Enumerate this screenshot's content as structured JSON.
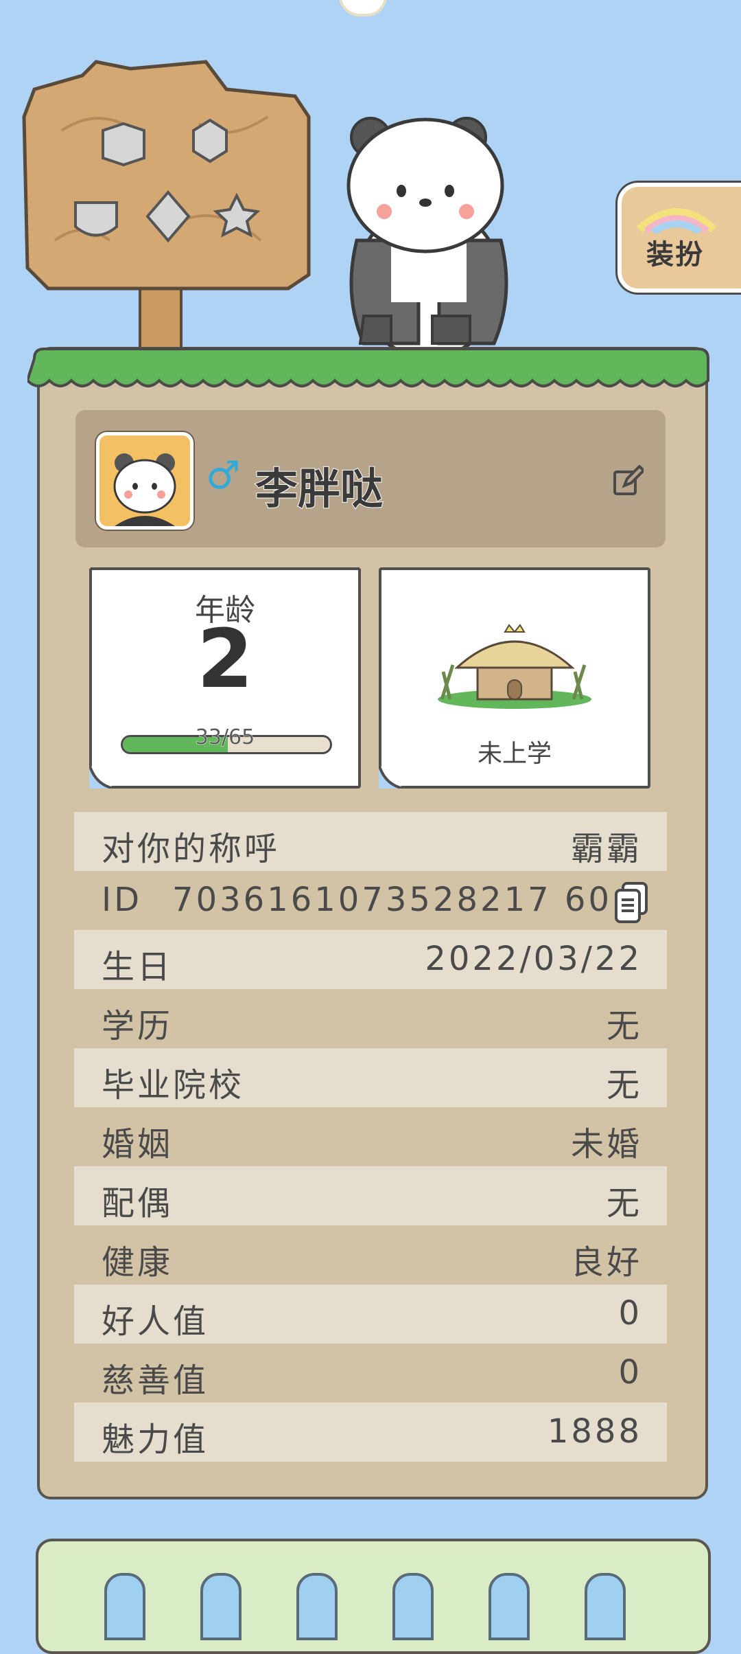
{
  "profile": {
    "nickname": "李胖哒",
    "gender_symbol": "♂"
  },
  "dress_button": {
    "label": "装扮"
  },
  "age_card": {
    "title": "年龄",
    "value": "2",
    "progress_text": "33/65",
    "progress_fraction": 0.507
  },
  "school_card": {
    "status": "未上学"
  },
  "info": {
    "address": {
      "label": "对你的称呼",
      "value": "霸霸"
    },
    "id": {
      "label": "ID",
      "value": "7036161073528217 60"
    },
    "birthday": {
      "label": "生日",
      "value": "2022/03/22"
    },
    "education": {
      "label": "学历",
      "value": "无"
    },
    "school": {
      "label": "毕业院校",
      "value": "无"
    },
    "marriage": {
      "label": "婚姻",
      "value": "未婚"
    },
    "spouse": {
      "label": "配偶",
      "value": "无"
    },
    "health": {
      "label": "健康",
      "value": "良好"
    },
    "good_person": {
      "label": "好人值",
      "value": "0"
    },
    "charity": {
      "label": "慈善值",
      "value": "0"
    },
    "charm": {
      "label": "魅力值",
      "value": "1888"
    }
  },
  "icons": {
    "edit": "edit-icon",
    "copy": "copy-icon",
    "gender": "male-icon"
  },
  "colors": {
    "sky": "#aed3f4",
    "board": "#d2c3a6",
    "grass": "#63b75b",
    "male": "#2eaad9"
  }
}
